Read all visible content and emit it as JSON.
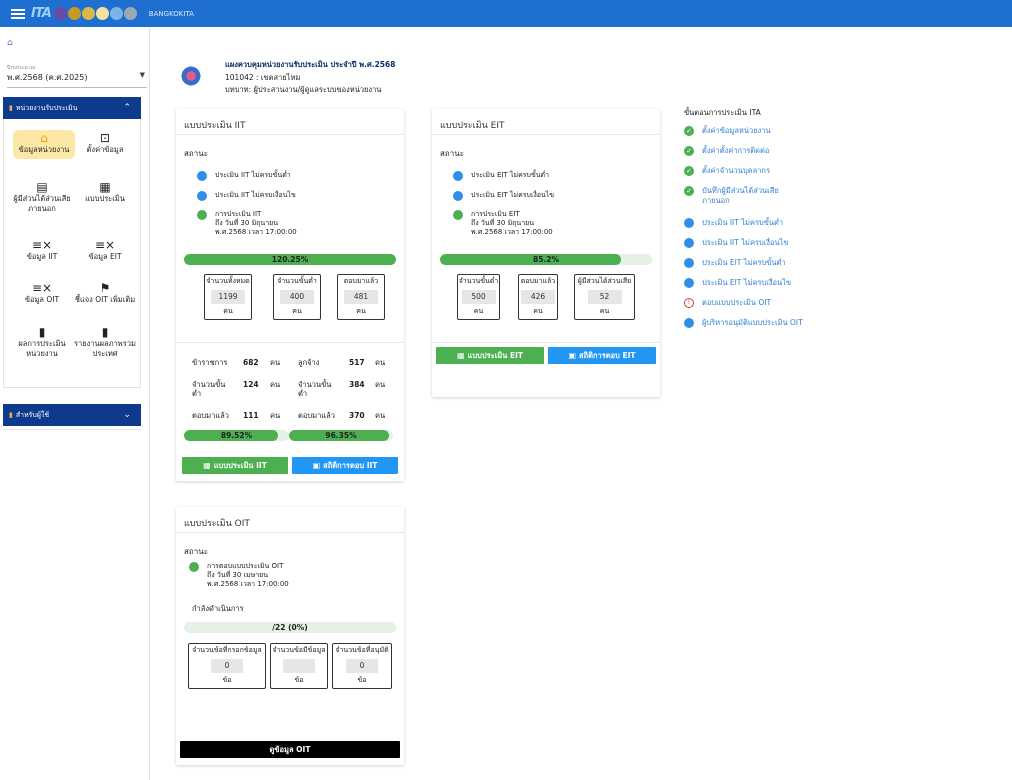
{
  "topbar": {
    "brand": "BANGKOKITA",
    "logo_text": "ITA"
  },
  "sidebar": {
    "year_label": "ปีงบประมาณ",
    "year_value": "พ.ศ.2568 (ค.ศ.2025)",
    "section1": "หน่วยงานรับประเมิน",
    "section2": "สำหรับผู้ใช้",
    "menu": [
      {
        "label": "ข้อมูลหน่วยงาน",
        "icon": "home-icon"
      },
      {
        "label": "ตั้งค่าข้อมูล",
        "icon": "settings-box-icon"
      },
      {
        "label": "ผู้มีส่วนได้ส่วนเสียภายนอก",
        "icon": "store-icon"
      },
      {
        "label": "แบบประเมิน",
        "icon": "qr-icon"
      },
      {
        "label": "ข้อมูล IIT",
        "icon": "list-check-icon"
      },
      {
        "label": "ข้อมูล EIT",
        "icon": "list-check-icon"
      },
      {
        "label": "ข้อมูล OIT",
        "icon": "list-check-icon"
      },
      {
        "label": "ชี้แจง OIT เพิ่มเติม",
        "icon": "flag-icon"
      },
      {
        "label": "ผลการประเมินหน่วยงาน",
        "icon": "bar-chart-icon"
      },
      {
        "label": "รายงานผลภาพรวมประเทศ",
        "icon": "bar-chart-icon"
      }
    ]
  },
  "header": {
    "title": "แผงควบคุมหน่วยงานรับประเมิน ประจำปี พ.ศ.2568",
    "org": "101042 : เขตสายไหม",
    "role": "บทบาท: ผู้ประสานงาน/ผู้ดูแลระบบของหน่วยงาน"
  },
  "iit": {
    "title": "แบบประเมิน IIT",
    "status_label": "สถานะ",
    "statuses": [
      {
        "text": "ประเมิน IIT ไม่ครบขั้นต่ำ",
        "color": "blue"
      },
      {
        "text": "ประเมิน IIT ไม่ครบเงื่อนไข",
        "color": "blue"
      },
      {
        "text": "การประเมิน IIT\nถึง วันที่ 30 มิถุนายน\nพ.ศ.2568 เวลา 17:00:00",
        "color": "green"
      }
    ],
    "progress": 100,
    "progress_text": "120.25%",
    "stats": [
      {
        "label": "จำนวนทั้งหมด",
        "value": "1199",
        "unit": "คน"
      },
      {
        "label": "จำนวนขั้นต่ำ",
        "value": "400",
        "unit": "คน"
      },
      {
        "label": "ตอบมาแล้ว",
        "value": "481",
        "unit": "คน"
      }
    ],
    "detail": {
      "civil_label": "ข้าราชการ",
      "civil_value": "682",
      "civil_unit": "คน",
      "emp_label": "ลูกจ้าง",
      "emp_value": "517",
      "emp_unit": "คน",
      "min1_label": "จำนวนขั้นต่ำ",
      "min1_value": "124",
      "min1_unit": "คน",
      "min2_label": "จำนวนขั้นต่ำ",
      "min2_value": "384",
      "min2_unit": "คน",
      "ans1_label": "ตอบมาแล้ว",
      "ans1_value": "111",
      "ans1_unit": "คน",
      "ans2_label": "ตอบมาแล้ว",
      "ans2_value": "370",
      "ans2_unit": "คน",
      "p1": 89.52,
      "p1_text": "89.52%",
      "p2": 96.35,
      "p2_text": "96.35%"
    },
    "btn_form": "แบบประเมิน IIT",
    "btn_stats": "สถิติการตอบ IIT"
  },
  "eit": {
    "title": "แบบประเมิน EIT",
    "status_label": "สถานะ",
    "statuses": [
      {
        "text": "ประเมิน EIT ไม่ครบขั้นต่ำ",
        "color": "blue"
      },
      {
        "text": "ประเมิน EIT ไม่ครบเงื่อนไข",
        "color": "blue"
      },
      {
        "text": "การประเมิน EIT\nถึง วันที่ 30 มิถุนายน\nพ.ศ.2568 เวลา 17:00:00",
        "color": "green"
      }
    ],
    "progress": 85.2,
    "progress_text": "85.2%",
    "stats": [
      {
        "label": "จำนวนขั้นต่ำ",
        "value": "500",
        "unit": "คน"
      },
      {
        "label": "ตอบมาแล้ว",
        "value": "426",
        "unit": "คน"
      },
      {
        "label": "ผู้มีส่วนได้ส่วนเสีย",
        "value": "52",
        "unit": "คน"
      }
    ],
    "btn_form": "แบบประเมิน EIT",
    "btn_stats": "สถิติการตอบ EIT"
  },
  "oit": {
    "title": "แบบประเมิน OIT",
    "status_label": "สถานะ",
    "status_text": "การตอบแบบประเมิน OIT\nถึง วันที่ 30 เมษายน\nพ.ศ.2568 เวลา 17:00:00",
    "inprogress": "กำลังดำเนินการ",
    "progress": 0,
    "progress_text": "/22 (0%)",
    "stats": [
      {
        "label": "จำนวนข้อที่กรอกข้อมูล",
        "value": "0",
        "unit": "ข้อ"
      },
      {
        "label": "จำนวนข้อมีข้อมูล",
        "value": "",
        "unit": "ข้อ"
      },
      {
        "label": "จำนวนข้อที่อนุมัติ",
        "value": "0",
        "unit": "ข้อ"
      }
    ],
    "btn": "ดูข้อมูล OIT"
  },
  "steps": {
    "title": "ขั้นตอนการประเมิน ITA",
    "items": [
      {
        "text": "ตั้งค่าข้อมูลหน่วยงาน",
        "state": "check"
      },
      {
        "text": "ตั้งค่าตั้งค่าการติดต่อ",
        "state": "check"
      },
      {
        "text": "ตั้งค่าจำนวนบุคลากร",
        "state": "check"
      },
      {
        "text": "บันทึกผู้มีส่วนได้ส่วนเสียภายนอก",
        "state": "check"
      },
      {
        "text": "ประเมิน IIT ไม่ครบขั้นต่ำ",
        "state": "blue"
      },
      {
        "text": "ประเมิน IIT ไม่ครบเงื่อนไข",
        "state": "blue"
      },
      {
        "text": "ประเมิน EIT ไม่ครบขั้นต่ำ",
        "state": "blue"
      },
      {
        "text": "ประเมิน EIT ไม่ครบเงื่อนไข",
        "state": "blue"
      },
      {
        "text": "ตอบแบบประเมิน OIT",
        "state": "warn"
      },
      {
        "text": "ผู้บริหารอนุมัติแบบประเมิน OIT",
        "state": "blue"
      }
    ]
  }
}
